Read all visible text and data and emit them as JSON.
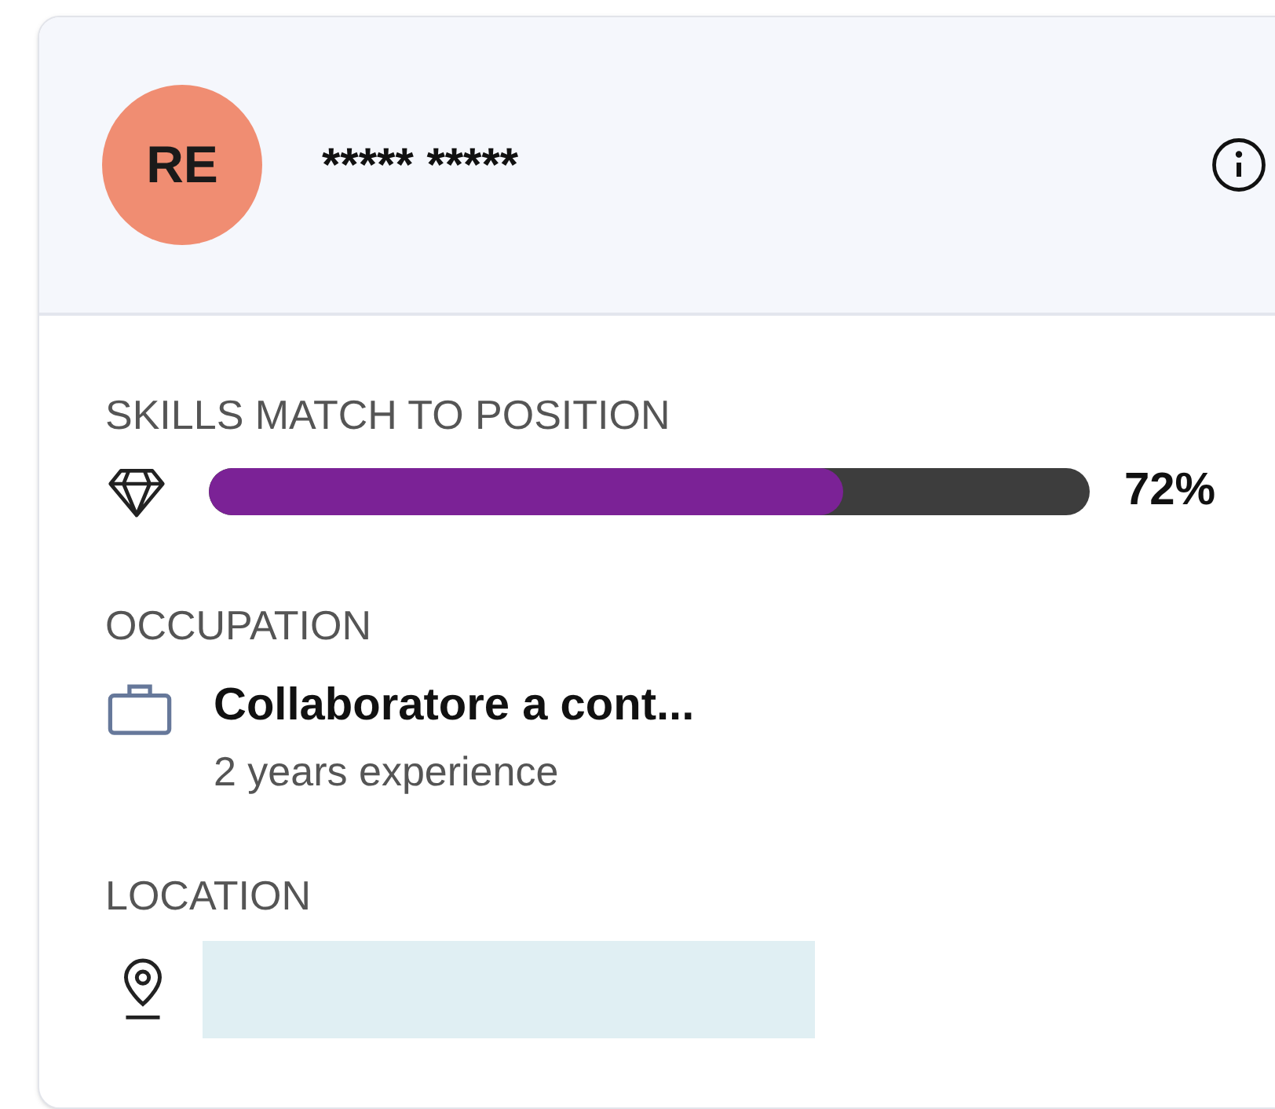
{
  "header": {
    "avatar_initials": "RE",
    "name": "***** *****"
  },
  "skills_match": {
    "label": "SKILLS MATCH TO POSITION",
    "level": 0.72,
    "reading": "72%"
  },
  "occupation": {
    "label": "OCCUPATION",
    "title": "Collaboratore a cont...",
    "experience": "2 years experience"
  },
  "location": {
    "label": "LOCATION"
  }
}
